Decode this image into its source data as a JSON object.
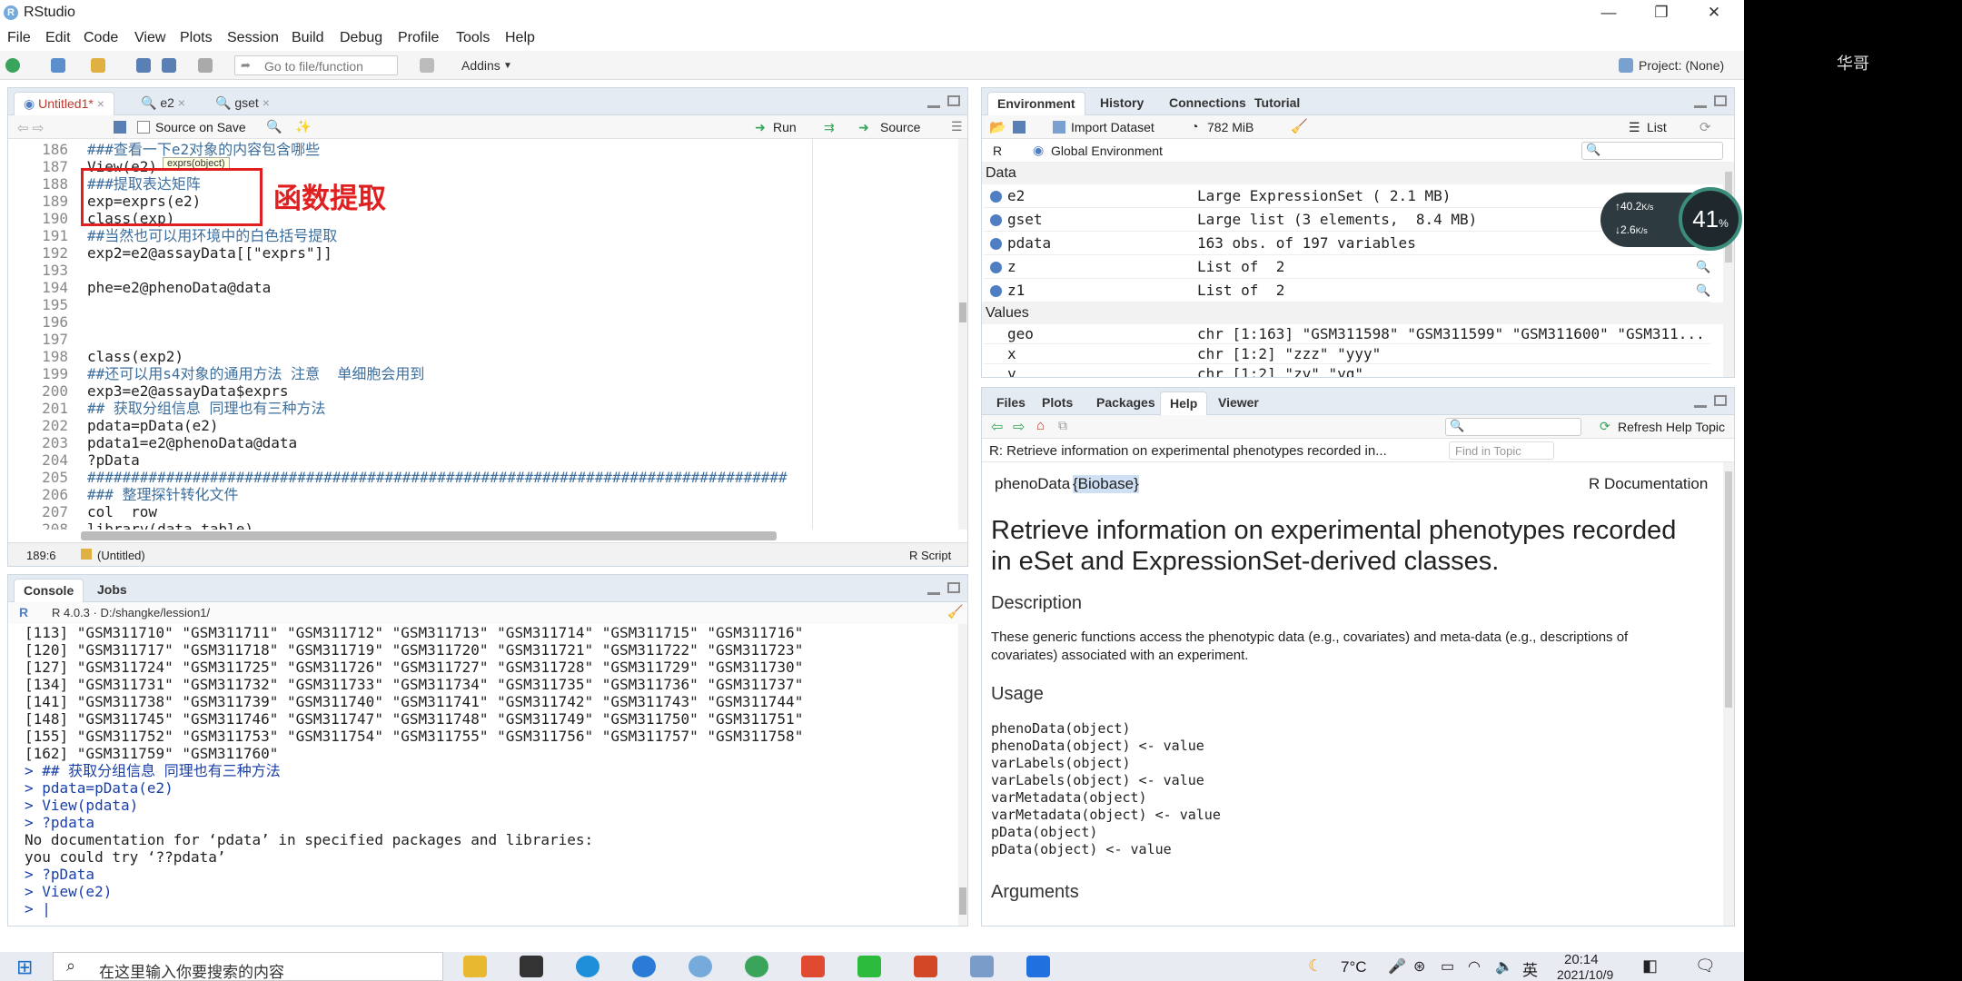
{
  "window": {
    "title": "RStudio",
    "min": "—",
    "max": "❐",
    "close": "✕"
  },
  "menu": [
    "File",
    "Edit",
    "Code",
    "View",
    "Plots",
    "Session",
    "Build",
    "Debug",
    "Profile",
    "Tools",
    "Help"
  ],
  "toolbar": {
    "goto_placeholder": "Go to file/function",
    "addins": "Addins",
    "project": "Project: (None)"
  },
  "editor": {
    "tabs": [
      "Untitled1*",
      "e2",
      "gset"
    ],
    "source_on_save": "Source on Save",
    "run": "Run",
    "source": "Source",
    "tooltip": "exprs(object)",
    "annotation": "函数提取",
    "status_pos": "189:6",
    "status_scope": "(Untitled)",
    "status_type": "R Script",
    "lines": [
      {
        "n": "186",
        "t": "###查看一下e2对象的内容包含哪些",
        "c": "cm"
      },
      {
        "n": "187",
        "t": "View(e2)",
        "c": ""
      },
      {
        "n": "188",
        "t": "###提取表达矩阵",
        "c": "cm"
      },
      {
        "n": "189",
        "t": "exp=exprs(e2)",
        "c": ""
      },
      {
        "n": "190",
        "t": "class(exp)",
        "c": ""
      },
      {
        "n": "191",
        "t": "##当然也可以用环境中的白色括号提取",
        "c": "cm"
      },
      {
        "n": "192",
        "t": "exp2=e2@assayData[[\"exprs\"]]",
        "c": ""
      },
      {
        "n": "193",
        "t": "",
        "c": ""
      },
      {
        "n": "194",
        "t": "phe=e2@phenoData@data",
        "c": ""
      },
      {
        "n": "195",
        "t": "",
        "c": ""
      },
      {
        "n": "196",
        "t": "",
        "c": ""
      },
      {
        "n": "197",
        "t": "",
        "c": ""
      },
      {
        "n": "198",
        "t": "class(exp2)",
        "c": ""
      },
      {
        "n": "199",
        "t": "##还可以用s4对象的通用方法 注意  单细胞会用到",
        "c": "cm"
      },
      {
        "n": "200",
        "t": "exp3=e2@assayData$exprs",
        "c": ""
      },
      {
        "n": "201",
        "t": "## 获取分组信息 同理也有三种方法",
        "c": "cm"
      },
      {
        "n": "202",
        "t": "pdata=pData(e2)",
        "c": ""
      },
      {
        "n": "203",
        "t": "pdata1=e2@phenoData@data",
        "c": ""
      },
      {
        "n": "204",
        "t": "?pData",
        "c": ""
      },
      {
        "n": "205",
        "t": "################################################################################",
        "c": "cm"
      },
      {
        "n": "206",
        "t": "### 整理探针转化文件",
        "c": "cm"
      },
      {
        "n": "207",
        "t": "col  row",
        "c": ""
      },
      {
        "n": "208",
        "t": "library(data.table)",
        "c": ""
      }
    ]
  },
  "console": {
    "tabs": [
      "Console",
      "Jobs"
    ],
    "path": "R 4.0.3 · D:/shangke/lession1/",
    "lines": [
      {
        "t": "[113] \"GSM311710\" \"GSM311711\" \"GSM311712\" \"GSM311713\" \"GSM311714\" \"GSM311715\" \"GSM311716\"",
        "cmd": false
      },
      {
        "t": "[120] \"GSM311717\" \"GSM311718\" \"GSM311719\" \"GSM311720\" \"GSM311721\" \"GSM311722\" \"GSM311723\"",
        "cmd": false
      },
      {
        "t": "[127] \"GSM311724\" \"GSM311725\" \"GSM311726\" \"GSM311727\" \"GSM311728\" \"GSM311729\" \"GSM311730\"",
        "cmd": false
      },
      {
        "t": "[134] \"GSM311731\" \"GSM311732\" \"GSM311733\" \"GSM311734\" \"GSM311735\" \"GSM311736\" \"GSM311737\"",
        "cmd": false
      },
      {
        "t": "[141] \"GSM311738\" \"GSM311739\" \"GSM311740\" \"GSM311741\" \"GSM311742\" \"GSM311743\" \"GSM311744\"",
        "cmd": false
      },
      {
        "t": "[148] \"GSM311745\" \"GSM311746\" \"GSM311747\" \"GSM311748\" \"GSM311749\" \"GSM311750\" \"GSM311751\"",
        "cmd": false
      },
      {
        "t": "[155] \"GSM311752\" \"GSM311753\" \"GSM311754\" \"GSM311755\" \"GSM311756\" \"GSM311757\" \"GSM311758\"",
        "cmd": false
      },
      {
        "t": "[162] \"GSM311759\" \"GSM311760\"",
        "cmd": false
      },
      {
        "t": "> ## 获取分组信息 同理也有三种方法",
        "cmd": true
      },
      {
        "t": "> pdata=pData(e2)",
        "cmd": true
      },
      {
        "t": "> View(pdata)",
        "cmd": true
      },
      {
        "t": "> ?pdata",
        "cmd": true
      },
      {
        "t": "No documentation for ‘pdata’ in specified packages and libraries:",
        "cmd": false
      },
      {
        "t": "you could try ‘??pdata’",
        "cmd": false
      },
      {
        "t": "> ?pData",
        "cmd": true
      },
      {
        "t": "> View(e2)",
        "cmd": true
      },
      {
        "t": "> |",
        "cmd": true
      }
    ]
  },
  "environment": {
    "tabs": [
      "Environment",
      "History",
      "Connections",
      "Tutorial"
    ],
    "import_dataset": "Import Dataset",
    "memory": "782 MiB",
    "list_view": "List",
    "lang": "R",
    "scope": "Global Environment",
    "data_header": "Data",
    "values_header": "Values",
    "data": [
      {
        "name": "e2",
        "value": "Large ExpressionSet ( 2.1 MB)"
      },
      {
        "name": "gset",
        "value": "Large list (3 elements,  8.4 MB)"
      },
      {
        "name": "pdata",
        "value": "163 obs. of 197 variables"
      },
      {
        "name": "z",
        "value": "List of  2"
      },
      {
        "name": "z1",
        "value": "List of  2"
      }
    ],
    "values": [
      {
        "name": "geo",
        "value": "chr [1:163] \"GSM311598\" \"GSM311599\" \"GSM311600\" \"GSM311..."
      },
      {
        "name": "x",
        "value": "chr [1:2] \"zzz\" \"yyy\""
      },
      {
        "name": "y",
        "value": "chr [1:2] \"zy\" \"yq\""
      }
    ]
  },
  "network_widget": {
    "up": "40.2",
    "up_unit": "K/s",
    "down": "2.6",
    "down_unit": "K/s",
    "cpu": "41",
    "cpu_unit": "%"
  },
  "help": {
    "tabs": [
      "Files",
      "Plots",
      "Packages",
      "Help",
      "Viewer"
    ],
    "refresh": "Refresh Help Topic",
    "topic_select": "R: Retrieve information on experimental phenotypes recorded in...",
    "find_placeholder": "Find in Topic",
    "pkg_name": "phenoData",
    "pkg_lib": "{Biobase}",
    "rdoc": "R Documentation",
    "title_line1": "Retrieve information on experimental phenotypes recorded",
    "title_line2": "in eSet and ExpressionSet-derived classes.",
    "description_h": "Description",
    "description_1": "These generic functions access the phenotypic data (e.g., covariates) and meta-data (e.g., descriptions of",
    "description_2": "covariates) associated with an experiment.",
    "usage_h": "Usage",
    "usage": [
      "phenoData(object)",
      "phenoData(object) <- value",
      "varLabels(object)",
      "varLabels(object) <- value",
      "varMetadata(object)",
      "varMetadata(object) <- value",
      "pData(object)",
      "pData(object) <- value"
    ],
    "arguments_h": "Arguments"
  },
  "taskbar": {
    "search_placeholder": "在这里输入你要搜索的内容",
    "weather": "7°C",
    "ime": "英",
    "time": "20:14",
    "date": "2021/10/9"
  },
  "sidebar": {
    "user": "华哥"
  },
  "colors": {
    "accent": "#4f7ec2",
    "annotation_red": "#e02020",
    "comment": "#3d6e9c"
  }
}
